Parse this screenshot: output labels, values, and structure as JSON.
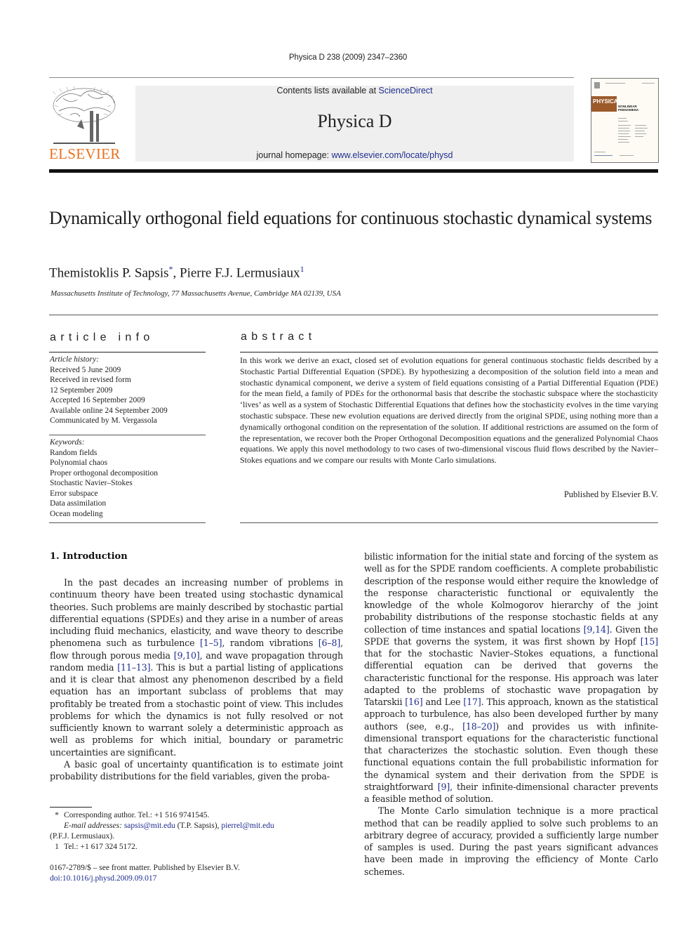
{
  "header": {
    "running_head": "Physica D 238 (2009) 2347–2360",
    "publisher_logo_text": "ELSEVIER",
    "contents_prefix": "Contents lists available at ",
    "contents_link": "ScienceDirect",
    "journal_name": "Physica D",
    "homepage_prefix": "journal homepage: ",
    "homepage_link": "www.elsevier.com/locate/physd",
    "cover_title": "PHYSICA",
    "cover_subtitle": "NONLINEAR PHENOMENA"
  },
  "article": {
    "title": "Dynamically orthogonal field equations for continuous stochastic dynamical systems",
    "authors": [
      {
        "name": "Themistoklis P. Sapsis",
        "mark": "*"
      },
      {
        "name": "Pierre F.J. Lermusiaux",
        "mark": "1"
      }
    ],
    "author_separator": ", ",
    "affiliation": "Massachusetts Institute of Technology, 77 Massachusetts Avenue, Cambridge MA 02139, USA"
  },
  "article_info": {
    "heading": "article info",
    "history_label": "Article history:",
    "history": [
      "Received 5 June 2009",
      "Received in revised form",
      "12 September 2009",
      "Accepted 16 September 2009",
      "Available online 24 September 2009",
      "Communicated by M. Vergassola"
    ],
    "keywords_label": "Keywords:",
    "keywords": [
      "Random fields",
      "Polynomial chaos",
      "Proper orthogonal decomposition",
      "Stochastic Navier–Stokes",
      "Error subspace",
      "Data assimilation",
      "Ocean modeling"
    ]
  },
  "abstract": {
    "heading": "abstract",
    "text": "In this work we derive an exact, closed set of evolution equations for general continuous stochastic fields described by a Stochastic Partial Differential Equation (SPDE). By hypothesizing a decomposition of the solution field into a mean and stochastic dynamical component, we derive a system of field equations consisting of a Partial Differential Equation (PDE) for the mean field, a family of PDEs for the orthonormal basis that describe the stochastic subspace where the stochasticity ‘lives’ as well as a system of Stochastic Differential Equations that defines how the stochasticity evolves in the time varying stochastic subspace. These new evolution equations are derived directly from the original SPDE, using nothing more than a dynamically orthogonal condition on the representation of the solution. If additional restrictions are assumed on the form of the representation, we recover both the Proper Orthogonal Decomposition equations and the generalized Polynomial Chaos equations. We apply this novel methodology to two cases of two-dimensional viscous fluid flows described by the Navier–Stokes equations and we compare our results with Monte Carlo simulations.",
    "published_by": "Published by Elsevier B.V."
  },
  "body": {
    "section_heading": "1.  Introduction",
    "p1": [
      "In the past decades an increasing number of problems in continuum theory have been treated using stochastic dynamical theories. Such problems are mainly described by stochastic partial differential equations (SPDEs) and they arise in a number of areas including fluid mechanics, elasticity, and wave theory to describe phenomena such as turbulence ",
      "[1–5]",
      ", random vibrations ",
      "[6–8]",
      ", flow through porous media ",
      "[9,10]",
      ", and wave propagation through random media ",
      "[11–13]",
      ". This is but a partial listing of applications and it is clear that almost any phenomenon described by a field equation has an important subclass of problems that may profitably be treated from a stochastic point of view. This includes problems for which the dynamics is not fully resolved or not sufficiently known to warrant solely a deterministic approach as well as problems for which initial, boundary or parametric uncertainties are significant."
    ],
    "p2": [
      "A basic goal of uncertainty quantification is to estimate joint probability distributions for the field variables, given the proba-",
      "bilistic information for the initial state and forcing of the system as well as for the SPDE random coefficients. A complete probabilistic description of the response would either require the knowledge of the response characteristic functional or equivalently the knowledge of the whole Kolmogorov hierarchy of the joint probability distributions of the response stochastic fields at any collection of time instances and spatial locations ",
      "[9,14]",
      ". Given the SPDE that governs the system, it was first shown by Hopf ",
      "[15]",
      " that for the stochastic Navier–Stokes equations, a functional differential equation can be derived that governs the characteristic functional for the response. His approach was later adapted to the problems of stochastic wave propagation by Tatarskii ",
      "[16]",
      " and Lee ",
      "[17]",
      ". This approach, known as the statistical approach to turbulence, has also been developed further by many authors (see, e.g., ",
      "[18–20]",
      ") and provides us with infinite-dimensional transport equations for the characteristic functional that characterizes the stochastic solution. Even though these functional equations contain the full probabilistic information for the dynamical system and their derivation from the SPDE is straightforward ",
      "[9]",
      ", their infinite-dimensional character prevents a feasible method of solution."
    ],
    "p3": "The Monte Carlo simulation technique is a more practical method that can be readily applied to solve such problems to an arbitrary degree of accuracy, provided a sufficiently large number of samples is used. During the past years significant advances have been made in improving the efficiency of Monte Carlo schemes."
  },
  "footnotes": {
    "star_mark": "*",
    "corresponding": "Corresponding author. Tel.: +1 516 9741545.",
    "email_label": "E-mail addresses: ",
    "email1": "sapsis@mit.edu",
    "email1_owner": " (T.P. Sapsis), ",
    "email2": "pierrel@mit.edu",
    "email2_owner": "(P.F.J. Lermusiaux).",
    "one_mark": "1",
    "tel2": "Tel.: +1 617 324 5172.",
    "issn_line": "0167-2789/$ – see front matter.  Published by Elsevier B.V.",
    "doi": "doi:10.1016/j.physd.2009.09.017"
  },
  "colors": {
    "link": "#1f2e8f",
    "elsevier_orange": "#e9711c",
    "banner_bg": "#efefef",
    "cover_band": "#9c5a2b"
  }
}
